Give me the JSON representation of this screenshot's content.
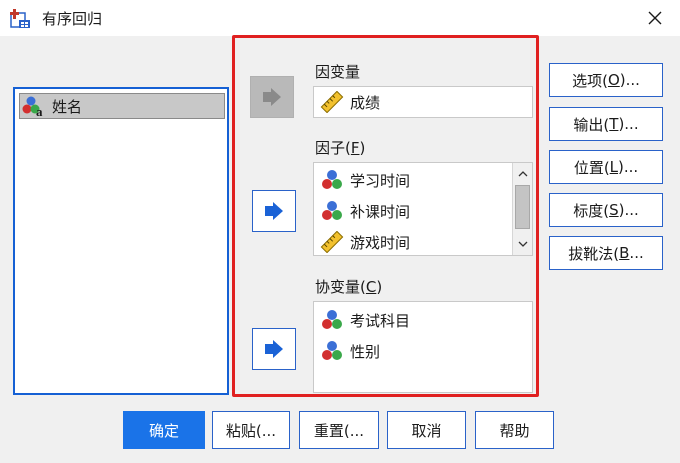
{
  "window": {
    "title": "有序回归",
    "close_symbol": "✕"
  },
  "source_list": {
    "items": [
      {
        "label": "姓名",
        "icon": "nominal-string-variable-icon"
      }
    ]
  },
  "dependent": {
    "label": "因变量",
    "variable": {
      "label": "成绩",
      "icon": "scale-ruler-icon"
    }
  },
  "factors": {
    "label": "因子(F)",
    "label_main": "因子(",
    "label_key": "F",
    "label_end": ")",
    "items": [
      {
        "label": "学习时间",
        "icon": "nominal-variable-icon"
      },
      {
        "label": "补课时间",
        "icon": "nominal-variable-icon"
      },
      {
        "label": "游戏时间",
        "icon": "scale-ruler-icon"
      }
    ]
  },
  "covariates": {
    "label": "协变量(C)",
    "label_main": "协变量(",
    "label_key": "C",
    "label_end": ")",
    "items": [
      {
        "label": "考试科目",
        "icon": "nominal-variable-icon"
      },
      {
        "label": "性别",
        "icon": "nominal-variable-icon"
      }
    ]
  },
  "side_buttons": [
    {
      "label": "选项(O)...",
      "main": "选项(",
      "key": "O",
      "end": ")..."
    },
    {
      "label": "输出(T)...",
      "main": "输出(",
      "key": "T",
      "end": ")..."
    },
    {
      "label": "位置(L)...",
      "main": "位置(",
      "key": "L",
      "end": ")..."
    },
    {
      "label": "标度(S)...",
      "main": "标度(",
      "key": "S",
      "end": ")..."
    },
    {
      "label": "拔靴法(B...",
      "main": "拔靴法(",
      "key": "B",
      "end": "..."
    }
  ],
  "bottom_buttons": {
    "ok": "确定",
    "paste": "粘贴(...",
    "reset": "重置(...",
    "cancel": "取消",
    "help": "帮助"
  },
  "colors": {
    "accent": "#1a73e8",
    "highlight_frame": "#e02020",
    "focus_border": "#1560d4"
  }
}
